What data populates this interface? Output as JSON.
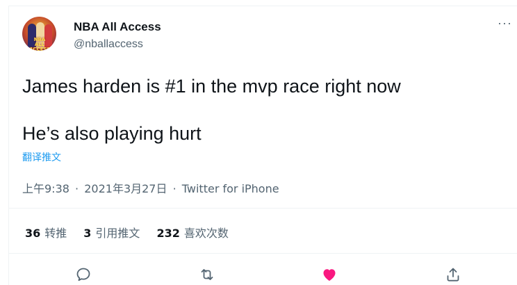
{
  "tweet": {
    "author_name": "NBA All Access",
    "author_handle": "@nballaccess",
    "avatar_text": "NBA ALL ACCESS",
    "more_label": "···",
    "text": "James harden is #1 in the mvp race right now\n\nHe’s also playing hurt",
    "translate_label": "翻译推文",
    "time": "上午9:38",
    "date": "2021年3月27日",
    "separator": "·",
    "source": "Twitter for iPhone"
  },
  "stats": {
    "retweets_count": "36",
    "retweets_label": "转推",
    "quotes_count": "3",
    "quotes_label": "引用推文",
    "likes_count": "232",
    "likes_label": "喜欢次数"
  },
  "actions": [
    {
      "icon": "reply-icon",
      "color": "#536471"
    },
    {
      "icon": "retweet-icon",
      "color": "#536471"
    },
    {
      "icon": "heart-icon",
      "color": "#f91880",
      "liked": true
    },
    {
      "icon": "share-icon",
      "color": "#536471"
    }
  ],
  "colors": {
    "accent": "#1d9bf0",
    "like": "#f91880",
    "secondary_text": "#536471",
    "primary_text": "#0f1419"
  }
}
